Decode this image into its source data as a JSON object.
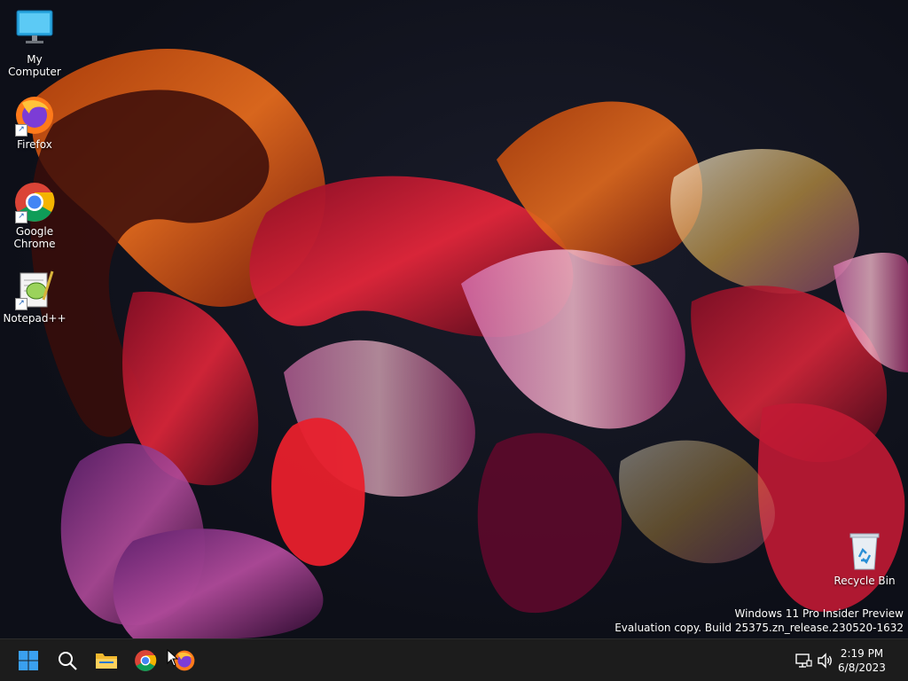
{
  "desktop": {
    "icons": [
      {
        "label": "My Computer",
        "icon": "monitor-icon"
      },
      {
        "label": "Firefox",
        "icon": "firefox-icon"
      },
      {
        "label": "Google\nChrome",
        "icon": "chrome-icon"
      },
      {
        "label": "Notepad++",
        "icon": "notepadpp-icon"
      },
      {
        "label": "Recycle Bin",
        "icon": "recycle-bin-icon"
      }
    ],
    "watermark": {
      "line1": "Windows 11 Pro Insider Preview",
      "line2": "Evaluation copy. Build 25375.zn_release.230520-1632"
    }
  },
  "taskbar": {
    "buttons": [
      {
        "name": "Start",
        "icon": "windows-logo-icon"
      },
      {
        "name": "Search",
        "icon": "search-icon"
      },
      {
        "name": "File Explorer",
        "icon": "folder-icon"
      },
      {
        "name": "Google Chrome",
        "icon": "chrome-icon"
      },
      {
        "name": "Firefox",
        "icon": "firefox-icon"
      }
    ],
    "tray": {
      "network_icon": "network-icon",
      "volume_icon": "volume-icon",
      "time": "2:19 PM",
      "date": "6/8/2023"
    }
  },
  "colors": {
    "taskbar_bg": "#1c1c1c",
    "accent": "#3aa0f0"
  }
}
